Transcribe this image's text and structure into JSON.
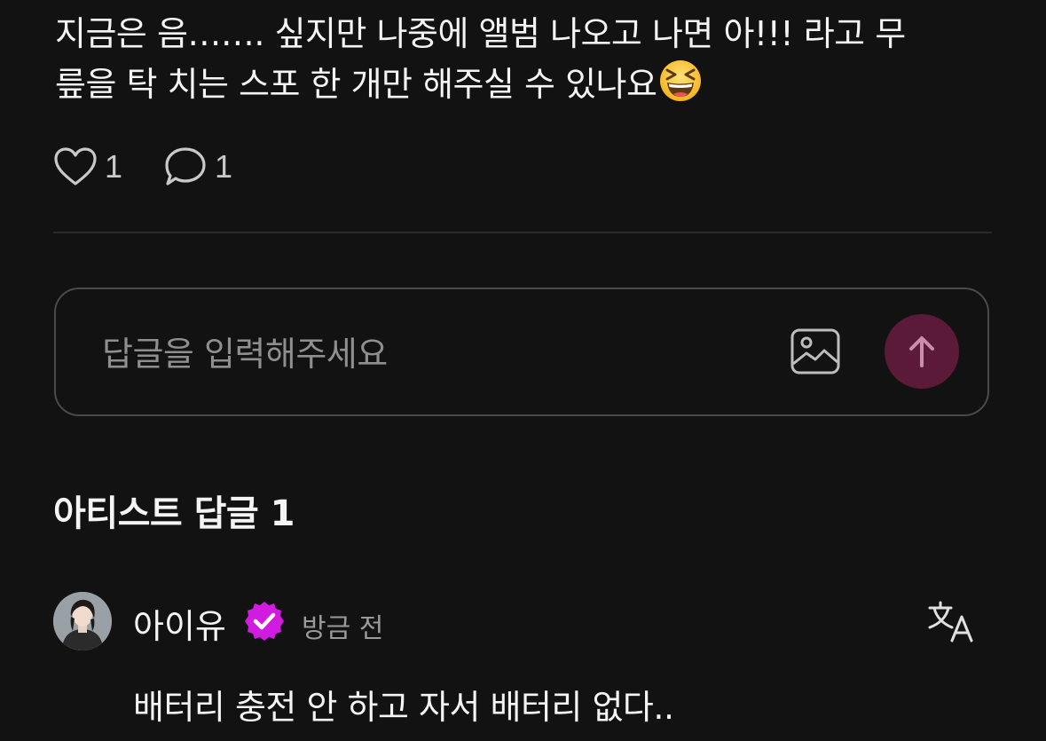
{
  "post": {
    "text_line1": "지금은 음……. 싶지만 나중에 앨범 나오고 나면 아!!! 라고 무",
    "text_line2": "릎을 탁 치는  스포 한 개만 해주실 수 있나요",
    "emoji": "grinning-squinting-face-emoji"
  },
  "reactions": {
    "like_icon": "heart-icon",
    "like_count": "1",
    "comment_icon": "speech-bubble-icon",
    "comment_count": "1"
  },
  "reply_box": {
    "placeholder": "답글을 입력해주세요",
    "image_icon": "image-icon",
    "send_icon": "arrow-up-icon"
  },
  "artist_replies": {
    "title": "아티스트 답글 1",
    "comments": [
      {
        "author": "아이유",
        "verified_icon": "verified-badge-icon",
        "time": "방금 전",
        "translate_icon": "translate-icon",
        "body": "배터리 충전 안 하고 자서 배터리 없다.."
      }
    ]
  },
  "colors": {
    "background": "#121212",
    "accent_send": "#5a1a38",
    "verified_badge": "#d21be0",
    "muted_text": "#8f8f8f"
  }
}
